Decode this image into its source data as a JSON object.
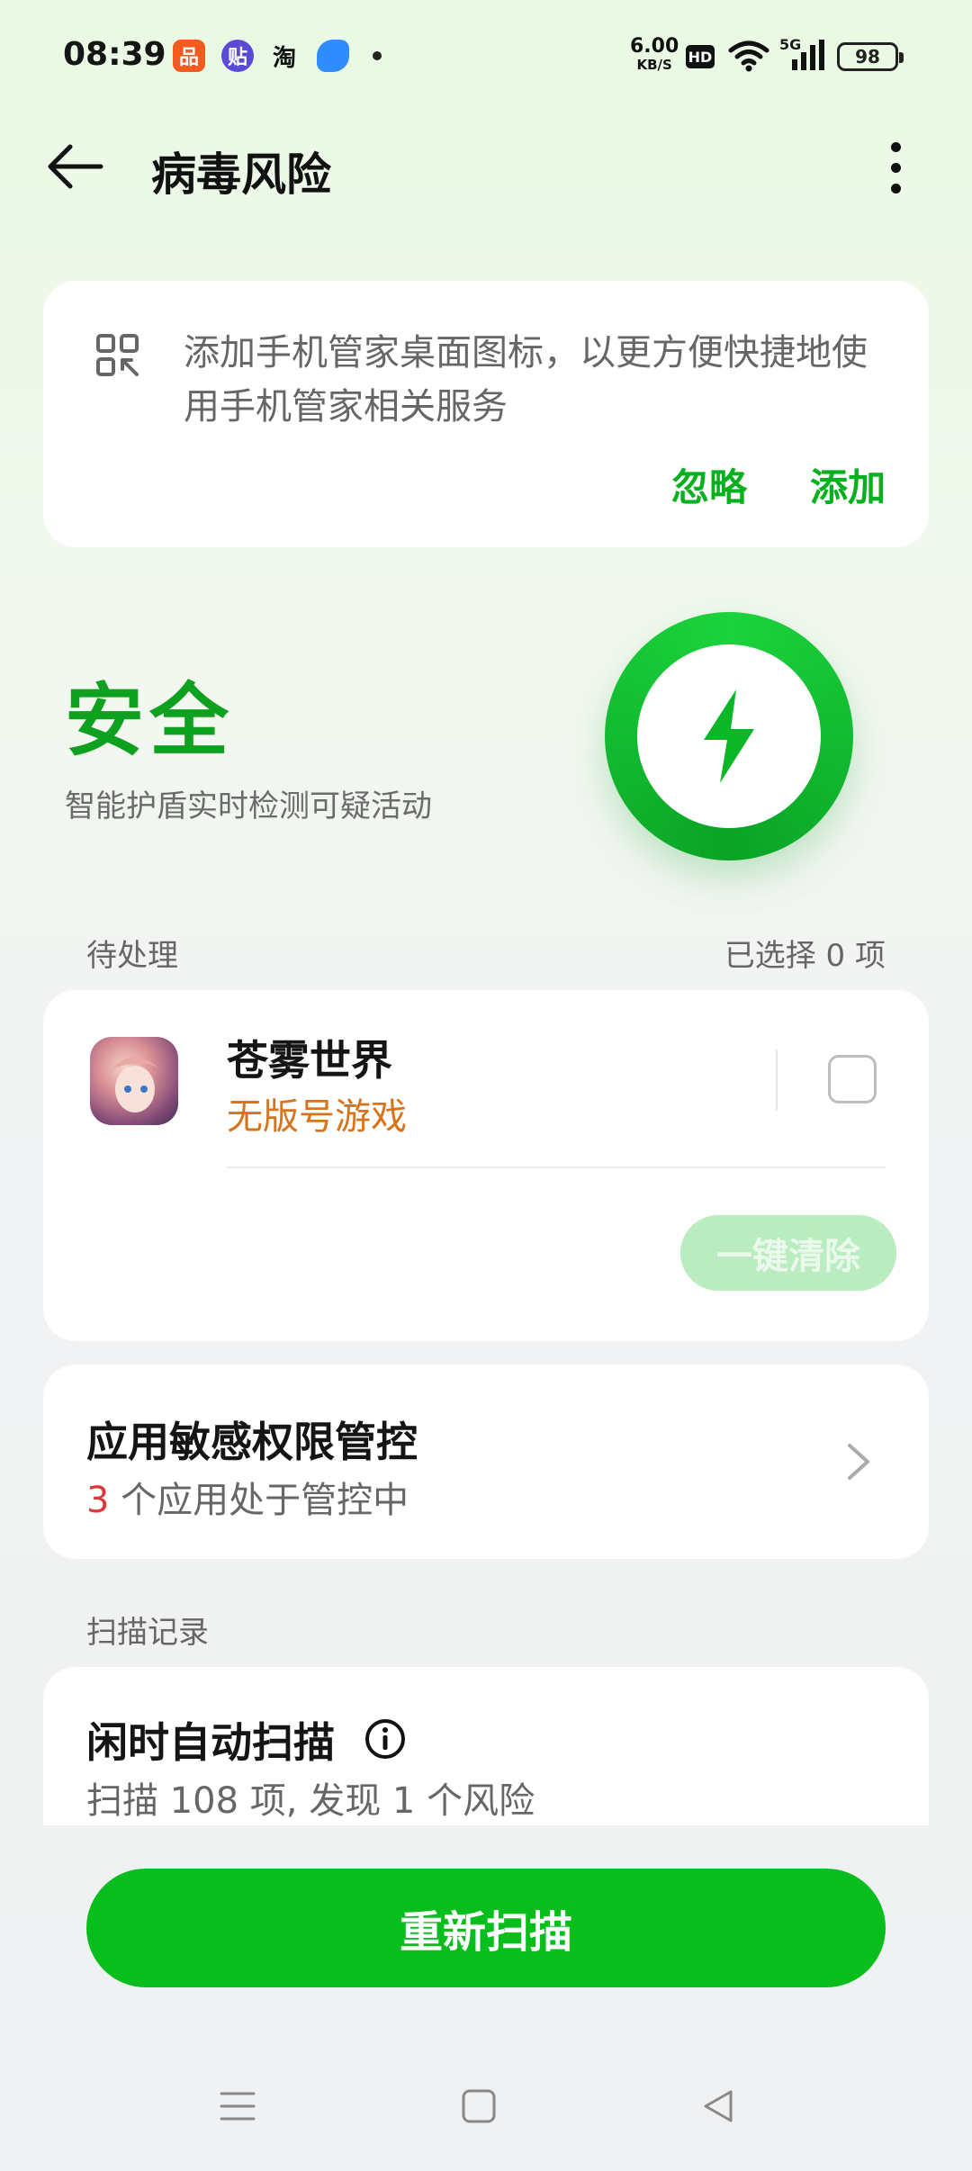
{
  "status_bar": {
    "time": "08:39",
    "app_icons": [
      {
        "name": "app-icon-orange",
        "glyph": "品",
        "color": "#f35a1f"
      },
      {
        "name": "app-icon-tie",
        "glyph": "贴",
        "color": "#5b4ad6"
      },
      {
        "name": "app-icon-taobao",
        "glyph": "淘",
        "color": "#ffffff"
      },
      {
        "name": "app-icon-blue",
        "glyph": "",
        "color": "#2f8cff"
      }
    ],
    "net_speed": "6.00",
    "net_unit": "KB/S",
    "hd": "HD",
    "signal": "5G",
    "battery": "98"
  },
  "header": {
    "title": "病毒风险"
  },
  "shortcut_card": {
    "message": "添加手机管家桌面图标，以更方便快捷地使用手机管家相关服务",
    "ignore_label": "忽略",
    "add_label": "添加"
  },
  "status": {
    "title": "安全",
    "subtitle": "智能护盾实时检测可疑活动"
  },
  "pending": {
    "label": "待处理",
    "selected": "已选择 0 项",
    "item": {
      "name": "苍雾世界",
      "tag": "无版号游戏"
    },
    "clean_label": "一键清除"
  },
  "permission": {
    "title": "应用敏感权限管控",
    "count": "3",
    "suffix": " 个应用处于管控中"
  },
  "scan_records": {
    "label": "扫描记录",
    "title": "闲时自动扫描",
    "summary": "扫描 108 项, 发现 1 个风险"
  },
  "rescan_label": "重新扫描",
  "colors": {
    "accent": "#08be1c",
    "safe_green": "#0ea01f",
    "warning_orange": "#d9731b",
    "count_red": "#d83a3a"
  }
}
